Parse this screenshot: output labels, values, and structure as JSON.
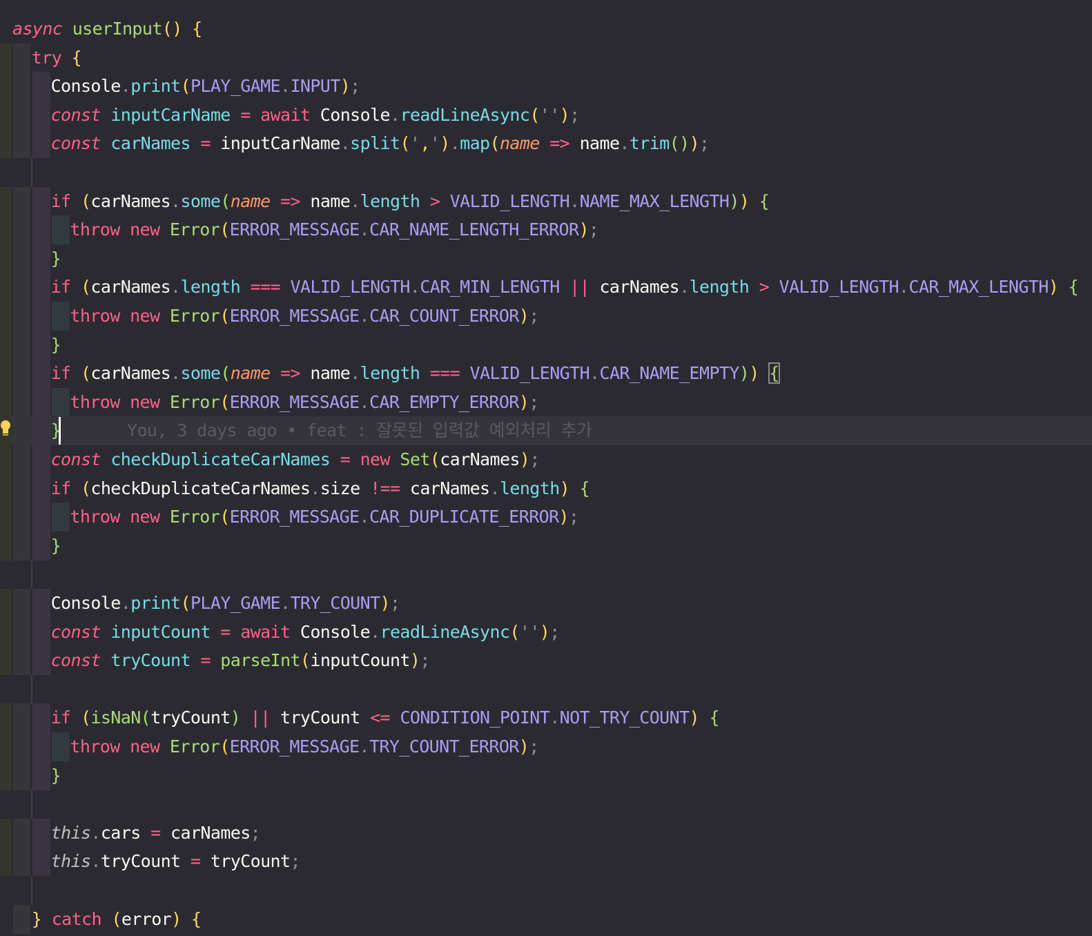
{
  "editor": {
    "lines": [
      "async userInput() {",
      "  try {",
      "    Console.print(PLAY_GAME.INPUT);",
      "    const inputCarName = await Console.readLineAsync('');",
      "    const carNames = inputCarName.split(',').map(name => name.trim());",
      "",
      "    if (carNames.some(name => name.length > VALID_LENGTH.NAME_MAX_LENGTH)) {",
      "      throw new Error(ERROR_MESSAGE.CAR_NAME_LENGTH_ERROR);",
      "    }",
      "    if (carNames.length === VALID_LENGTH.CAR_MIN_LENGTH || carNames.length > VALID_LENGTH.CAR_MAX_LENGTH) {",
      "      throw new Error(ERROR_MESSAGE.CAR_COUNT_ERROR);",
      "    }",
      "    if (carNames.some(name => name.length === VALID_LENGTH.CAR_NAME_EMPTY)) {",
      "      throw new Error(ERROR_MESSAGE.CAR_EMPTY_ERROR);",
      "    }",
      "    const checkDuplicateCarNames = new Set(carNames);",
      "    if (checkDuplicateCarNames.size !== carNames.length) {",
      "      throw new Error(ERROR_MESSAGE.CAR_DUPLICATE_ERROR);",
      "    }",
      "",
      "    Console.print(PLAY_GAME.TRY_COUNT);",
      "    const inputCount = await Console.readLineAsync('');",
      "    const tryCount = parseInt(inputCount);",
      "",
      "    if (isNaN(tryCount) || tryCount <= CONDITION_POINT.NOT_TRY_COUNT) {",
      "      throw new Error(ERROR_MESSAGE.TRY_COUNT_ERROR);",
      "    }",
      "",
      "    this.cars = carNames;",
      "    this.tryCount = tryCount;",
      "",
      "  } catch (error) {"
    ],
    "git_blame": "You, 3 days ago • feat : 잘못된 입력값 예외처리 추가",
    "current_line": 15,
    "lightbulb_icon": "lightbulb-icon",
    "colors": {
      "background": "#2b2a31",
      "keyword": "#ff6188",
      "function": "#a9dc76",
      "constant": "#ab9df2",
      "property": "#78dce8",
      "parameter": "#fc9867",
      "brace": "#ffd866",
      "blame_text": "#5b595f"
    }
  }
}
